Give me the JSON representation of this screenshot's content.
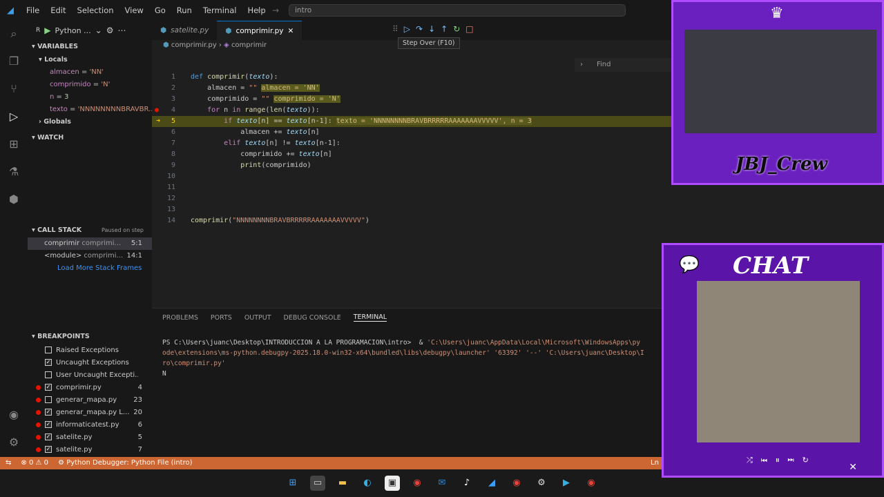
{
  "menu": [
    "File",
    "Edit",
    "Selection",
    "View",
    "Go",
    "Run",
    "Terminal",
    "Help"
  ],
  "search": {
    "text": "intro"
  },
  "sidebar": {
    "config": "Python ...",
    "variables_title": "VARIABLES",
    "locals_title": "Locals",
    "locals": [
      {
        "name": "almacen",
        "value": "'NN'"
      },
      {
        "name": "comprimido",
        "value": "'N'"
      },
      {
        "name": "n",
        "value": "3"
      },
      {
        "name": "texto",
        "value": "'NNNNNNNNBRAVBR..."
      }
    ],
    "globals_title": "Globals",
    "watch_title": "WATCH",
    "callstack_title": "CALL STACK",
    "callstack_status": "Paused on step",
    "callstack": [
      {
        "name": "comprimir",
        "file": "comprimi...",
        "pos": "5:1"
      },
      {
        "name": "<module>",
        "file": "comprimi...",
        "pos": "14:1"
      }
    ],
    "load_more": "Load More Stack Frames",
    "breakpoints_title": "BREAKPOINTS",
    "breakpoints": [
      {
        "label": "Raised Exceptions",
        "count": "",
        "checked": false,
        "dot": false
      },
      {
        "label": "Uncaught Exceptions",
        "count": "",
        "checked": true,
        "dot": false
      },
      {
        "label": "User Uncaught Excepti...",
        "count": "",
        "checked": false,
        "dot": false
      },
      {
        "label": "comprimir.py",
        "count": "4",
        "checked": true,
        "dot": true
      },
      {
        "label": "generar_mapa.py",
        "count": "23",
        "checked": false,
        "dot": true
      },
      {
        "label": "generar_mapa.py  L...",
        "count": "20",
        "checked": true,
        "dot": true
      },
      {
        "label": "informaticatest.py",
        "count": "6",
        "checked": true,
        "dot": true
      },
      {
        "label": "satelite.py",
        "count": "5",
        "checked": true,
        "dot": true
      },
      {
        "label": "satelite.py",
        "count": "7",
        "checked": true,
        "dot": true
      }
    ]
  },
  "tabs": [
    {
      "label": "satelite.py",
      "active": false
    },
    {
      "label": "comprimir.py",
      "active": true
    }
  ],
  "tooltip": "Step Over (F10)",
  "breadcrumb": {
    "file": "comprimir.py",
    "symbol": "comprimir"
  },
  "find_placeholder": "Find",
  "panel": {
    "tabs": [
      "PROBLEMS",
      "PORTS",
      "OUTPUT",
      "DEBUG CONSOLE",
      "TERMINAL"
    ],
    "active": "TERMINAL",
    "terminal_prompt": "PS C:\\Users\\juanc\\Desktop\\INTRODUCCION A LA PROGRAMACION\\intro>  & ",
    "terminal_cmd": "'C:\\Users\\juanc\\AppData\\Local\\Microsoft\\WindowsApps\\py ode\\extensions\\ms-python.debugpy-2025.18.0-win32-x64\\bundled\\libs\\debugpy\\launcher' '63392' '--' 'C:\\Users\\juanc\\Desktop\\I ro\\comprimir.py'",
    "terminal_output": "N"
  },
  "status": {
    "errors": "0",
    "warnings": "0",
    "debug": "Python Debugger: Python File (intro)",
    "ln": "Ln"
  },
  "overlay": {
    "crew": "JBJ_Crew",
    "chat": "CHAT"
  }
}
